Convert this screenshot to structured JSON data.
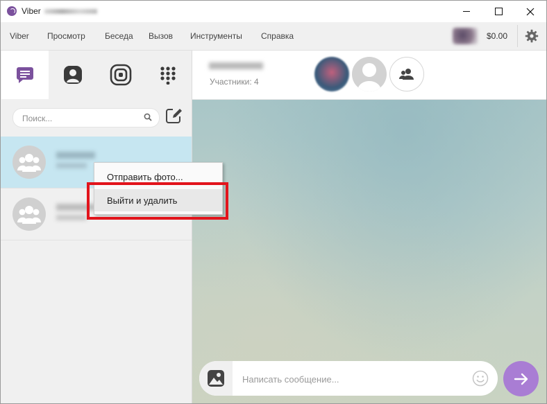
{
  "window": {
    "title": "Viber"
  },
  "menu": {
    "items": [
      "Viber",
      "Просмотр",
      "Беседа",
      "Вызов",
      "Инструменты",
      "Справка"
    ],
    "balance": "$0.00"
  },
  "search": {
    "placeholder": "Поиск..."
  },
  "context_menu": {
    "items": [
      "Отправить фото...",
      "Выйти и удалить"
    ]
  },
  "chat": {
    "participants": "Участники: 4"
  },
  "composer": {
    "placeholder": "Написать сообщение..."
  },
  "colors": {
    "brand": "#7b519d",
    "selected_row": "#c6e6f1",
    "send_button": "#a97dd4",
    "highlight_border": "#e2141c"
  },
  "icons": [
    "viber-logo-icon",
    "chats-icon",
    "contacts-icon",
    "stories-icon",
    "dialpad-icon",
    "search-icon",
    "compose-icon",
    "group-icon",
    "person-icon",
    "gear-icon",
    "photo-icon",
    "emoji-icon",
    "send-arrow-icon"
  ]
}
